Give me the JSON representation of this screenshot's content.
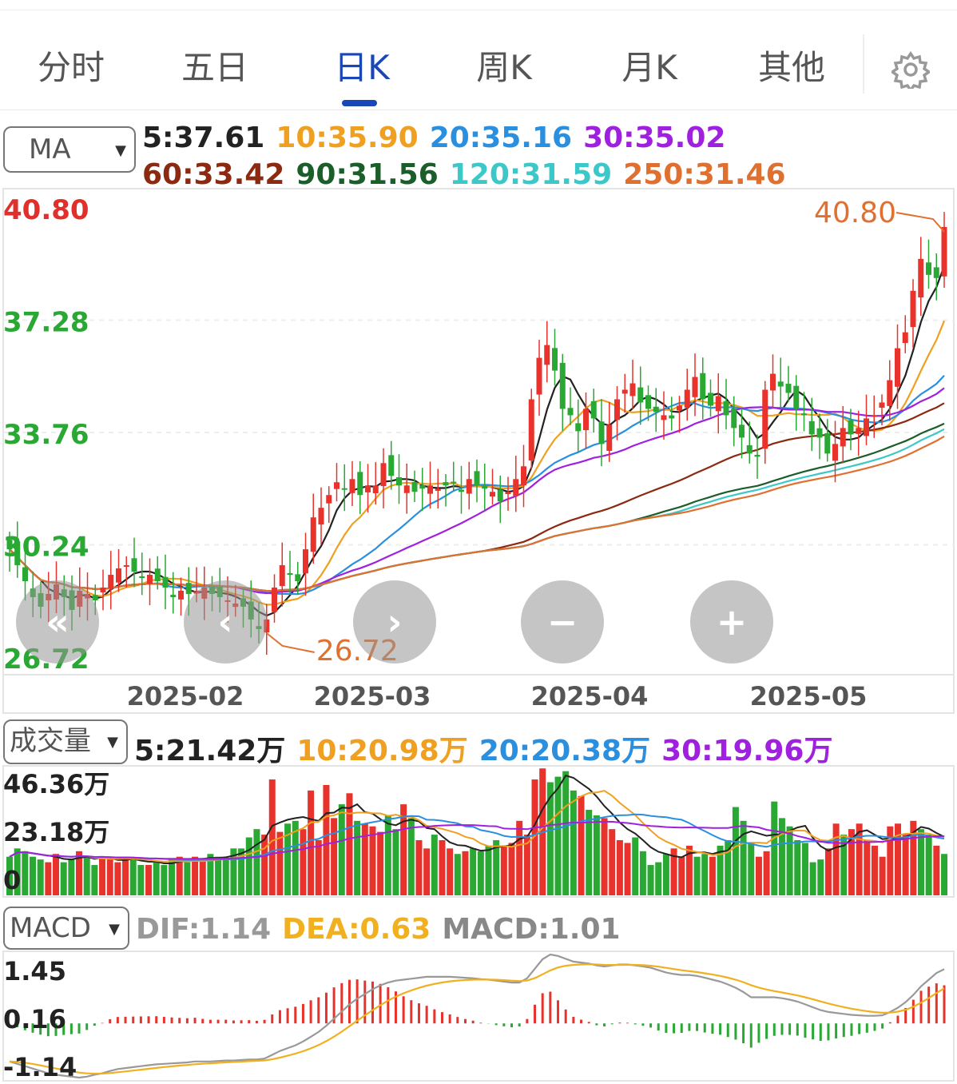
{
  "tabs": [
    {
      "label": "分时",
      "active": false
    },
    {
      "label": "五日",
      "active": false
    },
    {
      "label": "日K",
      "active": true
    },
    {
      "label": "周K",
      "active": false
    },
    {
      "label": "月K",
      "active": false
    },
    {
      "label": "其他",
      "active": false
    }
  ],
  "settings_icon": "gear-icon",
  "price_panel": {
    "indicator": "MA",
    "ma_legend": [
      {
        "label": "5:37.61",
        "color": "#222222"
      },
      {
        "label": "10:35.90",
        "color": "#f0a020"
      },
      {
        "label": "20:35.16",
        "color": "#2b8fe0"
      },
      {
        "label": "30:35.02",
        "color": "#a020e0"
      },
      {
        "label": "60:33.42",
        "color": "#8b2a10"
      },
      {
        "label": "90:31.56",
        "color": "#1b5e2a"
      },
      {
        "label": "120:31.59",
        "color": "#3cc8c8"
      },
      {
        "label": "250:31.46",
        "color": "#e07030"
      }
    ],
    "y_labels": [
      {
        "text": "40.80",
        "color": "#e0302c"
      },
      {
        "text": "37.28",
        "color": "#2aa834"
      },
      {
        "text": "33.76",
        "color": "#2aa834"
      },
      {
        "text": "30.24",
        "color": "#2aa834"
      },
      {
        "text": "26.72",
        "color": "#2aa834"
      }
    ],
    "max_marker": "40.80",
    "min_marker": "26.72",
    "x_labels": [
      "2025-02",
      "2025-03",
      "2025-04",
      "2025-05"
    ]
  },
  "controls": [
    {
      "name": "scroll-start-button",
      "glyph": "«"
    },
    {
      "name": "scroll-left-button",
      "glyph": "‹"
    },
    {
      "name": "scroll-right-button",
      "glyph": "›"
    },
    {
      "name": "zoom-out-button",
      "glyph": "−"
    },
    {
      "name": "zoom-in-button",
      "glyph": "+"
    }
  ],
  "volume_panel": {
    "indicator": "成交量",
    "legend": [
      {
        "label": "5:21.42万",
        "color": "#222222"
      },
      {
        "label": "10:20.98万",
        "color": "#f0a020"
      },
      {
        "label": "20:20.38万",
        "color": "#2b8fe0"
      },
      {
        "label": "30:19.96万",
        "color": "#a020e0"
      }
    ],
    "y_labels": [
      "46.36万",
      "23.18万",
      "0"
    ]
  },
  "macd_panel": {
    "indicator": "MACD",
    "legend": [
      {
        "label": "DIF:1.14",
        "color": "#999999"
      },
      {
        "label": "DEA:0.63",
        "color": "#f0b020"
      },
      {
        "label": "MACD:1.01",
        "color": "#888888"
      }
    ],
    "y_labels": [
      "1.45",
      "0.16",
      "-1.14"
    ]
  },
  "colors": {
    "up": "#e8322c",
    "down": "#2aa834",
    "accent": "#1a47b8"
  },
  "chart_data": [
    {
      "type": "candlestick",
      "title": "",
      "ylim": [
        26.72,
        40.8
      ],
      "x_ticks": [
        "2025-02",
        "2025-03",
        "2025-04",
        "2025-05"
      ],
      "closes": [
        30.1,
        29.6,
        29.1,
        28.6,
        28.3,
        28.7,
        29.0,
        28.6,
        28.2,
        28.8,
        28.7,
        28.5,
        28.9,
        29.3,
        29.5,
        29.6,
        29.4,
        29.2,
        29.3,
        29.1,
        28.9,
        28.6,
        28.8,
        28.7,
        28.8,
        28.9,
        28.7,
        28.6,
        28.5,
        28.4,
        28.3,
        27.9,
        27.6,
        27.9,
        28.9,
        29.6,
        29.3,
        29.1,
        30.1,
        31.1,
        31.4,
        31.8,
        32.2,
        32.0,
        32.3,
        31.8,
        32.1,
        32.1,
        32.8,
        32.4,
        32.1,
        32.1,
        31.9,
        32.0,
        32.1,
        32.0,
        32.1,
        32.2,
        31.9,
        32.3,
        32.1,
        32.0,
        31.9,
        31.6,
        31.9,
        32.3,
        32.7,
        34.8,
        36.1,
        36.5,
        35.7,
        34.5,
        34.3,
        33.8,
        34.5,
        34.2,
        33.4,
        34.0,
        34.8,
        35.1,
        35.3,
        34.7,
        34.5,
        34.4,
        34.3,
        34.2,
        34.6,
        35.1,
        35.5,
        34.8,
        34.6,
        34.9,
        34.3,
        33.9,
        33.6,
        33.1,
        33.0,
        35.1,
        35.6,
        35.2,
        35.0,
        34.5,
        34.3,
        33.7,
        33.6,
        33.1,
        33.4,
        33.9,
        33.7,
        33.9,
        34.2,
        34.3,
        34.7,
        35.4,
        36.4,
        36.9,
        38.2,
        39.2,
        38.7,
        38.6,
        40.2
      ],
      "markers": {
        "max": 40.8,
        "min": 26.72
      },
      "moving_averages": {
        "MA5": 37.61,
        "MA10": 35.9,
        "MA20": 35.16,
        "MA30": 35.02,
        "MA60": 33.42,
        "MA90": 31.56,
        "MA120": 31.59,
        "MA250": 31.46
      }
    },
    {
      "type": "bar",
      "title": "成交量",
      "ylim": [
        0,
        46.36
      ],
      "unit": "万",
      "volumes": [
        14,
        17,
        16,
        14,
        13,
        12,
        15,
        12,
        13,
        16,
        14,
        11,
        14,
        13,
        12,
        14,
        13,
        11,
        11,
        12,
        11,
        13,
        14,
        12,
        14,
        13,
        15,
        14,
        13,
        17,
        17,
        21,
        24,
        22,
        42,
        23,
        26,
        27,
        24,
        38,
        20,
        40,
        28,
        33,
        37,
        27,
        26,
        25,
        23,
        29,
        24,
        33,
        28,
        20,
        17,
        22,
        20,
        17,
        15,
        16,
        17,
        16,
        18,
        20,
        18,
        19,
        27,
        22,
        42,
        46,
        41,
        43,
        45,
        38,
        36,
        31,
        29,
        28,
        24,
        20,
        19,
        21,
        16,
        11,
        12,
        15,
        17,
        14,
        18,
        14,
        15,
        14,
        18,
        20,
        32,
        27,
        19,
        14,
        16,
        34,
        28,
        25,
        20,
        19,
        12,
        13,
        17,
        26,
        22,
        24,
        26,
        20,
        18,
        14,
        25,
        26,
        22,
        27,
        24,
        22,
        18,
        15
      ],
      "moving_averages": {
        "MA5": 21.42,
        "MA10": 20.98,
        "MA20": 20.38,
        "MA30": 19.96
      }
    },
    {
      "type": "line",
      "title": "MACD",
      "ylim": [
        -1.14,
        1.45
      ],
      "series": [
        {
          "name": "DIF",
          "current": 1.14
        },
        {
          "name": "DEA",
          "current": 0.63
        },
        {
          "name": "MACD",
          "current": 1.01
        }
      ],
      "dif": [
        -0.8,
        -0.85,
        -0.9,
        -0.95,
        -1.0,
        -1.05,
        -1.08,
        -1.1,
        -1.12,
        -1.14,
        -1.12,
        -1.08,
        -1.05,
        -1.0,
        -0.96,
        -0.94,
        -0.92,
        -0.9,
        -0.88,
        -0.86,
        -0.85,
        -0.84,
        -0.83,
        -0.82,
        -0.8,
        -0.8,
        -0.8,
        -0.79,
        -0.78,
        -0.78,
        -0.77,
        -0.76,
        -0.76,
        -0.74,
        -0.66,
        -0.58,
        -0.52,
        -0.46,
        -0.38,
        -0.28,
        -0.18,
        -0.05,
        0.1,
        0.25,
        0.4,
        0.52,
        0.62,
        0.72,
        0.8,
        0.86,
        0.9,
        0.92,
        0.94,
        0.96,
        0.98,
        0.98,
        0.98,
        0.98,
        0.97,
        0.96,
        0.95,
        0.93,
        0.92,
        0.9,
        0.88,
        0.86,
        0.86,
        0.95,
        1.15,
        1.35,
        1.45,
        1.42,
        1.36,
        1.3,
        1.28,
        1.26,
        1.22,
        1.2,
        1.22,
        1.24,
        1.24,
        1.22,
        1.2,
        1.17,
        1.12,
        1.07,
        1.04,
        1.02,
        1.02,
        1.0,
        0.96,
        0.92,
        0.88,
        0.82,
        0.75,
        0.66,
        0.55,
        0.55,
        0.55,
        0.55,
        0.53,
        0.5,
        0.46,
        0.4,
        0.34,
        0.28,
        0.24,
        0.22,
        0.2,
        0.18,
        0.17,
        0.16,
        0.16,
        0.17,
        0.24,
        0.33,
        0.45,
        0.6,
        0.78,
        0.92,
        1.06,
        1.14
      ]
    }
  ]
}
